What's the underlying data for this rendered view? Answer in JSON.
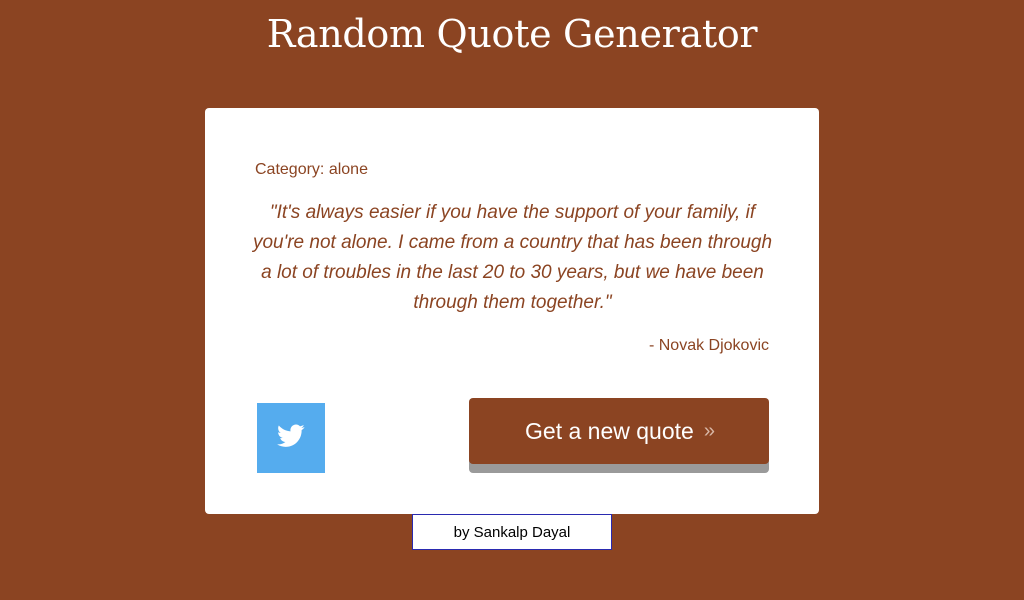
{
  "header": {
    "title": "Random Quote Generator"
  },
  "card": {
    "category_prefix": "Category:",
    "category": "alone",
    "category_full": "Category: alone",
    "quote": "\"It's always easier if you have the support of your family, if you're not alone. I came from a country that has been through a lot of troubles in the last 20 to 30 years, but we have been through them together.\"",
    "author": "- Novak Djokovic",
    "tweet_icon": "twitter-bird-icon",
    "new_quote_label": "Get a new quote",
    "new_quote_arrow": "»"
  },
  "footer": {
    "credit": "by Sankalp Dayal"
  },
  "colors": {
    "background": "#8b4422",
    "card": "#ffffff",
    "accent_text": "#8b4422",
    "twitter": "#55acee",
    "button_shadow": "#9a9a9a"
  }
}
